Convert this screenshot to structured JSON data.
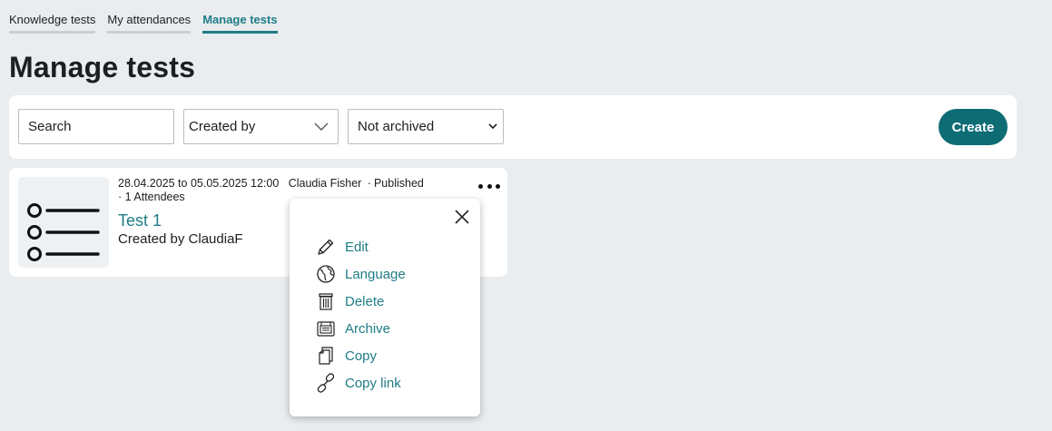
{
  "tabs": [
    {
      "label": "Knowledge tests",
      "active": false
    },
    {
      "label": "My attendances",
      "active": false
    },
    {
      "label": "Manage tests",
      "active": true
    }
  ],
  "page_title": "Manage tests",
  "filters": {
    "search_placeholder": "Search",
    "created_by_label": "Created by",
    "archived_select": {
      "value": "Not archived"
    },
    "create_label": "Create"
  },
  "card": {
    "date_from": "28.04.2025",
    "to_label": "to",
    "date_to": "05.05.2025 12:00",
    "author": "Claudia Fisher",
    "status": "Published",
    "attendees": "1 Attendees",
    "title": "Test 1",
    "created_by": "Created by ClaudiaF",
    "icon": "list-icon"
  },
  "menu": {
    "items": [
      {
        "label": "Edit",
        "icon": "pencil-icon"
      },
      {
        "label": "Language",
        "icon": "globe-icon"
      },
      {
        "label": "Delete",
        "icon": "trash-icon"
      },
      {
        "label": "Archive",
        "icon": "archive-icon"
      },
      {
        "label": "Copy",
        "icon": "copy-icon"
      },
      {
        "label": "Copy link",
        "icon": "link-icon"
      }
    ]
  },
  "colors": {
    "accent": "#1f7c86",
    "button": "#0e6c75",
    "background": "#e9edf0"
  }
}
